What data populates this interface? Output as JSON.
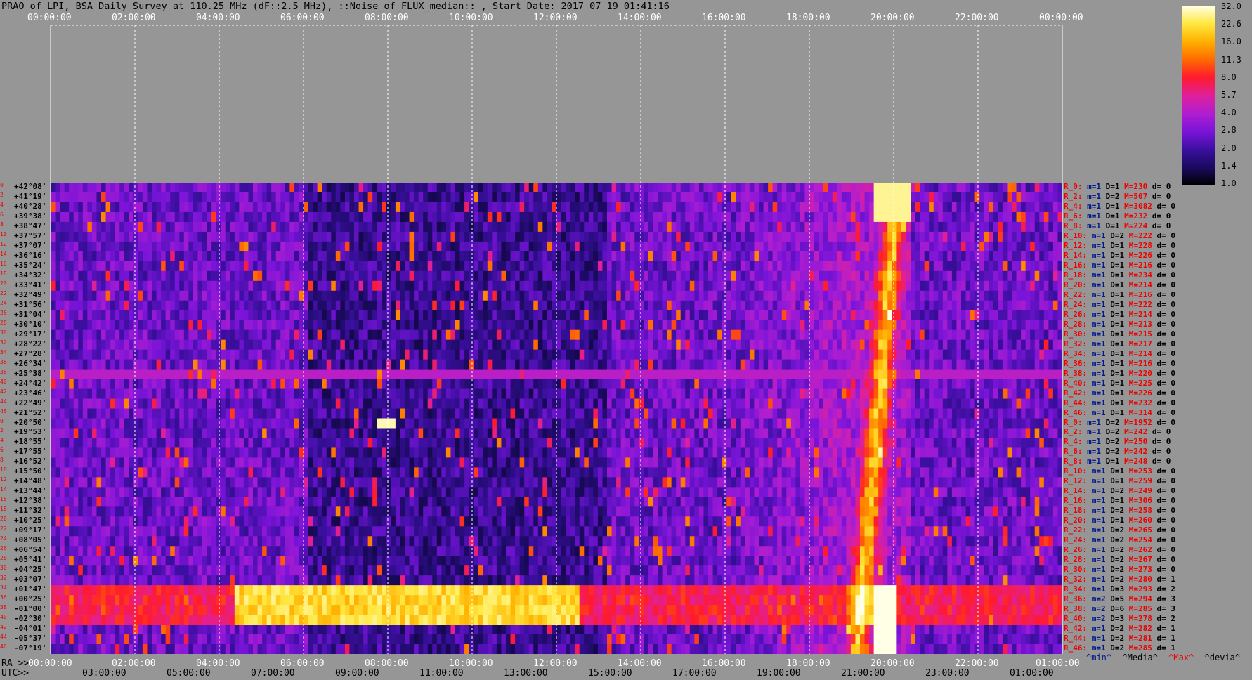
{
  "title": "PRAO of LPI, BSA Daily Survey at 110.25 MHz (dF::2.5 MHz), ::Noise_of_FLUX_median:: , Start Date: 2017 07 19 01:41:16",
  "ra_prefix": "RA >>",
  "utc_prefix": "UTC>>",
  "chart_data": {
    "type": "heatmap",
    "title": "PRAO of LPI, BSA Daily Survey at 110.25 MHz (dF::2.5 MHz), ::Noise_of_FLUX_median:: , Start Date: 2017 07 19 01:41:16",
    "x_top_ticks": [
      "00:00:00",
      "02:00:00",
      "04:00:00",
      "06:00:00",
      "08:00:00",
      "10:00:00",
      "12:00:00",
      "14:00:00",
      "16:00:00",
      "18:00:00",
      "20:00:00",
      "22:00:00",
      "00:00:00"
    ],
    "x_ra_ticks": [
      "00:00:00",
      "02:00:00",
      "04:00:00",
      "06:00:00",
      "08:00:00",
      "10:00:00",
      "12:00:00",
      "14:00:00",
      "16:00:00",
      "18:00:00",
      "20:00:00",
      "22:00:00",
      "01:00:00"
    ],
    "x_utc_ticks": [
      "03:00:00",
      "05:00:00",
      "07:00:00",
      "09:00:00",
      "11:00:00",
      "13:00:00",
      "15:00:00",
      "17:00:00",
      "19:00:00",
      "21:00:00",
      "23:00:00",
      "01:00:00"
    ],
    "declinations": [
      "+42°08'",
      "+41°19'",
      "+40°28'",
      "+39°38'",
      "+38°47'",
      "+37°57'",
      "+37°07'",
      "+36°16'",
      "+35°24'",
      "+34°32'",
      "+33°41'",
      "+32°49'",
      "+31°56'",
      "+31°04'",
      "+30°10'",
      "+29°17'",
      "+28°22'",
      "+27°28'",
      "+26°34'",
      "+25°38'",
      "+24°42'",
      "+23°46'",
      "+22°49'",
      "+21°52'",
      "+20°50'",
      "+19°53'",
      "+18°55'",
      "+17°55'",
      "+16°52'",
      "+15°50'",
      "+14°48'",
      "+13°44'",
      "+12°38'",
      "+11°32'",
      "+10°25'",
      "+09°17'",
      "+08°05'",
      "+06°54'",
      "+05°41'",
      "+04°25'",
      "+03°07'",
      "+01°47'",
      "+00°25'",
      "-01°00'",
      "-02°30'",
      "-04°01'",
      "-05°37'",
      "-07°19'"
    ],
    "row_indices": [
      "0",
      "2",
      "4",
      "6",
      "8",
      "10",
      "12",
      "14",
      "16",
      "18",
      "20",
      "22",
      "24",
      "26",
      "28",
      "30",
      "32",
      "34",
      "36",
      "38",
      "40",
      "42",
      "44",
      "46",
      "0",
      "2",
      "4",
      "6",
      "8",
      "10",
      "12",
      "14",
      "16",
      "18",
      "20",
      "22",
      "24",
      "26",
      "28",
      "30",
      "32",
      "34",
      "36",
      "38",
      "40",
      "42",
      "44",
      "46"
    ],
    "colorbar": {
      "ticks": [
        "32.0",
        "22.6",
        "16.0",
        "11.3",
        "8.0",
        "5.7",
        "4.0",
        "2.8",
        "2.0",
        "1.4",
        "1.0"
      ],
      "colors": [
        "#000000",
        "#1a0a5e",
        "#3c0fa0",
        "#7a14d8",
        "#b01ed0",
        "#e0209a",
        "#ff1a2e",
        "#ff6a00",
        "#ffb000",
        "#ffe840",
        "#ffffe6"
      ]
    },
    "stats": [
      {
        "r": "R_0:",
        "m": "m=1",
        "d": "D=1",
        "M": "M=230",
        "dev": "d= 0"
      },
      {
        "r": "R_2:",
        "m": "m=1",
        "d": "D=2",
        "M": "M=507",
        "dev": "d= 0"
      },
      {
        "r": "R_4:",
        "m": "m=1",
        "d": "D=1",
        "M": "M=3082",
        "dev": "d= 0"
      },
      {
        "r": "R_6:",
        "m": "m=1",
        "d": "D=1",
        "M": "M=232",
        "dev": "d= 0"
      },
      {
        "r": "R_8:",
        "m": "m=1",
        "d": "D=1",
        "M": "M=224",
        "dev": "d= 0"
      },
      {
        "r": "R_10:",
        "m": "m=1",
        "d": "D=2",
        "M": "M=222",
        "dev": "d= 0"
      },
      {
        "r": "R_12:",
        "m": "m=1",
        "d": "D=1",
        "M": "M=228",
        "dev": "d= 0"
      },
      {
        "r": "R_14:",
        "m": "m=1",
        "d": "D=1",
        "M": "M=226",
        "dev": "d= 0"
      },
      {
        "r": "R_16:",
        "m": "m=1",
        "d": "D=1",
        "M": "M=216",
        "dev": "d= 0"
      },
      {
        "r": "R_18:",
        "m": "m=1",
        "d": "D=1",
        "M": "M=234",
        "dev": "d= 0"
      },
      {
        "r": "R_20:",
        "m": "m=1",
        "d": "D=1",
        "M": "M=214",
        "dev": "d= 0"
      },
      {
        "r": "R_22:",
        "m": "m=1",
        "d": "D=1",
        "M": "M=216",
        "dev": "d= 0"
      },
      {
        "r": "R_24:",
        "m": "m=1",
        "d": "D=1",
        "M": "M=222",
        "dev": "d= 0"
      },
      {
        "r": "R_26:",
        "m": "m=1",
        "d": "D=1",
        "M": "M=214",
        "dev": "d= 0"
      },
      {
        "r": "R_28:",
        "m": "m=1",
        "d": "D=1",
        "M": "M=213",
        "dev": "d= 0"
      },
      {
        "r": "R_30:",
        "m": "m=1",
        "d": "D=1",
        "M": "M=215",
        "dev": "d= 0"
      },
      {
        "r": "R_32:",
        "m": "m=1",
        "d": "D=1",
        "M": "M=217",
        "dev": "d= 0"
      },
      {
        "r": "R_34:",
        "m": "m=1",
        "d": "D=1",
        "M": "M=214",
        "dev": "d= 0"
      },
      {
        "r": "R_36:",
        "m": "m=1",
        "d": "D=1",
        "M": "M=216",
        "dev": "d= 0"
      },
      {
        "r": "R_38:",
        "m": "m=1",
        "d": "D=1",
        "M": "M=220",
        "dev": "d= 0"
      },
      {
        "r": "R_40:",
        "m": "m=1",
        "d": "D=1",
        "M": "M=225",
        "dev": "d= 0"
      },
      {
        "r": "R_42:",
        "m": "m=1",
        "d": "D=1",
        "M": "M=226",
        "dev": "d= 0"
      },
      {
        "r": "R_44:",
        "m": "m=1",
        "d": "D=1",
        "M": "M=232",
        "dev": "d= 0"
      },
      {
        "r": "R_46:",
        "m": "m=1",
        "d": "D=1",
        "M": "M=314",
        "dev": "d= 0"
      },
      {
        "r": "R_0:",
        "m": "m=1",
        "d": "D=2",
        "M": "M=1952",
        "dev": "d= 0"
      },
      {
        "r": "R_2:",
        "m": "m=1",
        "d": "D=2",
        "M": "M=242",
        "dev": "d= 0"
      },
      {
        "r": "R_4:",
        "m": "m=1",
        "d": "D=2",
        "M": "M=250",
        "dev": "d= 0"
      },
      {
        "r": "R_6:",
        "m": "m=1",
        "d": "D=2",
        "M": "M=242",
        "dev": "d= 0"
      },
      {
        "r": "R_8:",
        "m": "m=1",
        "d": "D=1",
        "M": "M=248",
        "dev": "d= 0"
      },
      {
        "r": "R_10:",
        "m": "m=1",
        "d": "D=1",
        "M": "M=253",
        "dev": "d= 0"
      },
      {
        "r": "R_12:",
        "m": "m=1",
        "d": "D=1",
        "M": "M=259",
        "dev": "d= 0"
      },
      {
        "r": "R_14:",
        "m": "m=1",
        "d": "D=2",
        "M": "M=249",
        "dev": "d= 0"
      },
      {
        "r": "R_16:",
        "m": "m=1",
        "d": "D=1",
        "M": "M=306",
        "dev": "d= 0"
      },
      {
        "r": "R_18:",
        "m": "m=1",
        "d": "D=2",
        "M": "M=258",
        "dev": "d= 0"
      },
      {
        "r": "R_20:",
        "m": "m=1",
        "d": "D=1",
        "M": "M=260",
        "dev": "d= 0"
      },
      {
        "r": "R_22:",
        "m": "m=1",
        "d": "D=2",
        "M": "M=265",
        "dev": "d= 0"
      },
      {
        "r": "R_24:",
        "m": "m=1",
        "d": "D=2",
        "M": "M=254",
        "dev": "d= 0"
      },
      {
        "r": "R_26:",
        "m": "m=1",
        "d": "D=2",
        "M": "M=262",
        "dev": "d= 0"
      },
      {
        "r": "R_28:",
        "m": "m=1",
        "d": "D=2",
        "M": "M=267",
        "dev": "d= 0"
      },
      {
        "r": "R_30:",
        "m": "m=1",
        "d": "D=2",
        "M": "M=273",
        "dev": "d= 0"
      },
      {
        "r": "R_32:",
        "m": "m=1",
        "d": "D=2",
        "M": "M=280",
        "dev": "d= 1"
      },
      {
        "r": "R_34:",
        "m": "m=1",
        "d": "D=3",
        "M": "M=293",
        "dev": "d= 2"
      },
      {
        "r": "R_36:",
        "m": "m=2",
        "d": "D=5",
        "M": "M=294",
        "dev": "d= 3"
      },
      {
        "r": "R_38:",
        "m": "m=2",
        "d": "D=6",
        "M": "M=285",
        "dev": "d= 3"
      },
      {
        "r": "R_40:",
        "m": "m=2",
        "d": "D=3",
        "M": "M=278",
        "dev": "d= 2"
      },
      {
        "r": "R_42:",
        "m": "m=1",
        "d": "D=2",
        "M": "M=282",
        "dev": "d= 1"
      },
      {
        "r": "R_44:",
        "m": "m=1",
        "d": "D=2",
        "M": "M=281",
        "dev": "d= 1"
      },
      {
        "r": "R_46:",
        "m": "m=1",
        "d": "D=2",
        "M": "M=285",
        "dev": "d= 1"
      }
    ],
    "legend": [
      "^min^",
      "^Media^",
      "^Max^",
      "^devia^"
    ],
    "legend_colors": [
      "#001a8c",
      "#000000",
      "#ee0000",
      "#000000"
    ]
  }
}
